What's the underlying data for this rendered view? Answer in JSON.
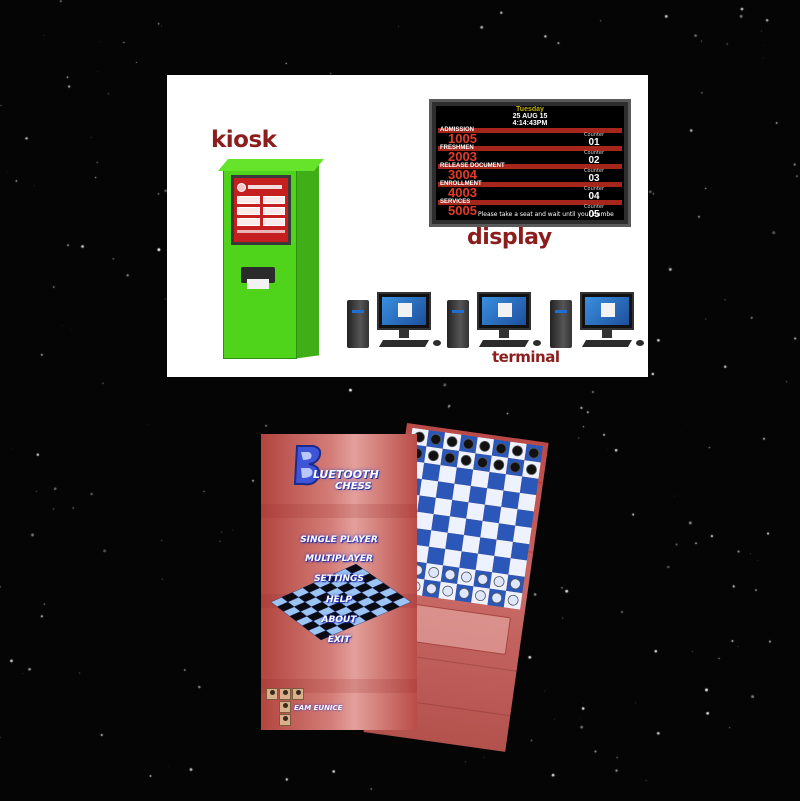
{
  "queue_panel": {
    "kiosk_label": "kiosk",
    "display_label": "display",
    "terminal_label": "terminal",
    "display_board": {
      "day": "Tuesday",
      "date": "25 AUG 15",
      "time": "4:14:43PM",
      "counter_label": "Counter",
      "rows": [
        {
          "service": "ADMISSION",
          "ticket": "1005",
          "counter": "01"
        },
        {
          "service": "FRESHMEN",
          "ticket": "2003",
          "counter": "02"
        },
        {
          "service": "RELEASE DOCUMENT",
          "ticket": "3004",
          "counter": "03"
        },
        {
          "service": "ENROLLMENT",
          "ticket": "4003",
          "counter": "04"
        },
        {
          "service": "SERVICES",
          "ticket": "5005",
          "counter": "05"
        }
      ],
      "ticker": "Please take a seat and wait until your numbe"
    },
    "colors": {
      "kiosk_green": "#4fd41b",
      "label_red": "#8c1d1d",
      "board_red": "#e23b2a"
    }
  },
  "chess_app": {
    "title_line1": "LUETOOTH",
    "title_line2": "CHESS",
    "logo_icon": "bluetooth-b-logo-icon",
    "menu": {
      "items": [
        {
          "label": "SINGLE PLAYER"
        },
        {
          "label": "MULTIPLAYER"
        },
        {
          "label": "SETTINGS"
        },
        {
          "label": "HELP"
        },
        {
          "label": "ABOUT"
        },
        {
          "label": "EXIT"
        }
      ]
    },
    "team_name": "EAM EUNICE",
    "colors": {
      "background_red": "#b94a47",
      "text_glow": "#2436d8",
      "board_blue": "#2b57b8"
    }
  }
}
